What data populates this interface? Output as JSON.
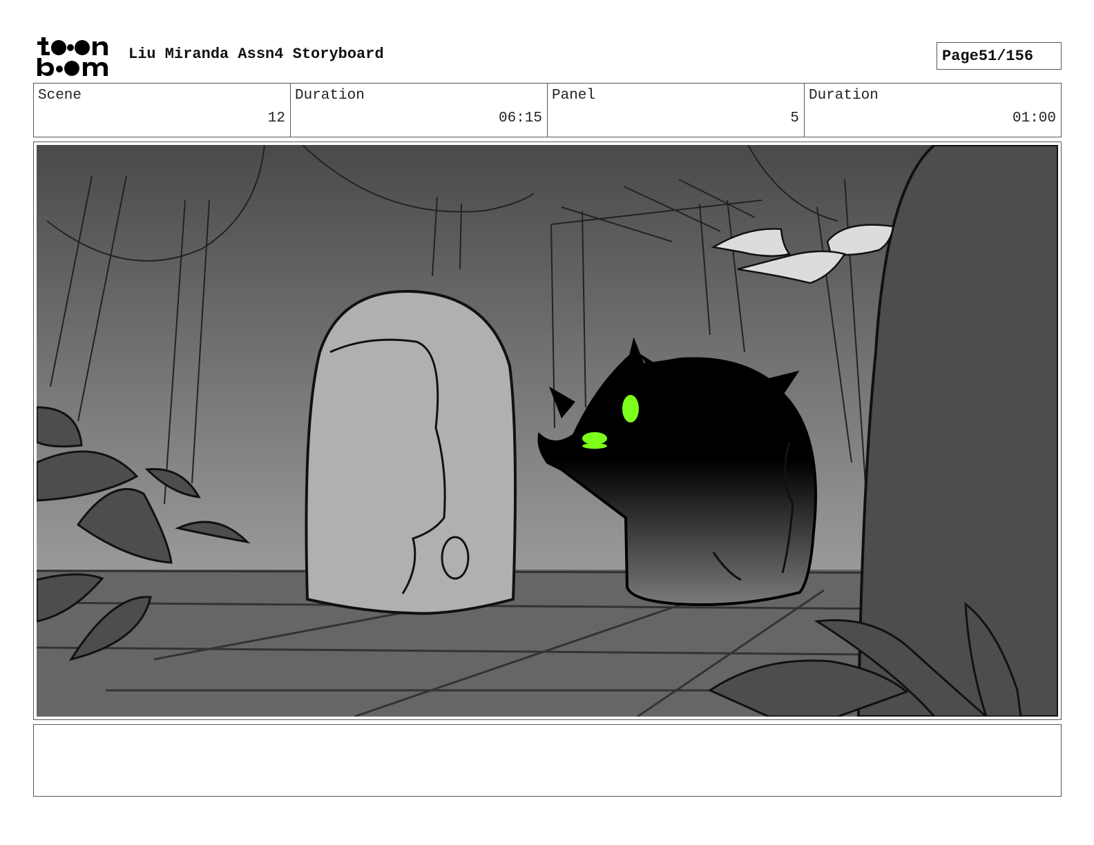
{
  "header": {
    "logo_line1": "toon",
    "logo_line2": "boom",
    "title": "Liu Miranda Assn4 Storyboard",
    "page_label": "Page",
    "page_value": "51/156"
  },
  "info": {
    "scene_label": "Scene",
    "scene_value": "12",
    "scene_duration_label": "Duration",
    "scene_duration_value": "06:15",
    "panel_label": "Panel",
    "panel_value": "5",
    "panel_duration_label": "Duration",
    "panel_duration_value": "01:00"
  },
  "panel": {
    "colors": {
      "sky_top": "#4a4a4a",
      "sky_bottom": "#9a9a9a",
      "floor": "#666666",
      "stone": "#b0b0b0",
      "creature": "#000000",
      "eyes": "#7cff1a",
      "bird": "#dcdcdc",
      "right_wall": "#4d4d4d"
    }
  },
  "notes": {
    "text": ""
  }
}
